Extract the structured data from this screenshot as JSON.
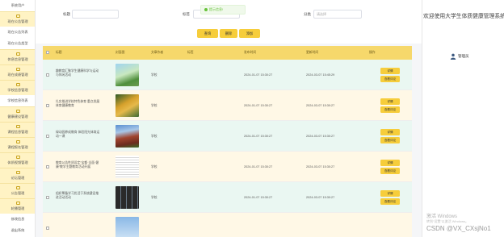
{
  "sidebar": {
    "items": [
      {
        "label": "系统用户",
        "group": false
      },
      {
        "label": "现在公告管理",
        "group": true
      },
      {
        "label": "现在公告列表",
        "group": false
      },
      {
        "label": "现在公告类型",
        "group": false
      },
      {
        "label": "休息信息管理",
        "group": true
      },
      {
        "label": "现在成绩管理",
        "group": true
      },
      {
        "label": "学校信息管理",
        "group": true
      },
      {
        "label": "学校信息列表",
        "group": false
      },
      {
        "label": "健康建议管理",
        "group": true
      },
      {
        "label": "课程信息管理",
        "group": true
      },
      {
        "label": "课程报名管理",
        "group": true
      },
      {
        "label": "体质视频管理",
        "group": true
      },
      {
        "label": "论坛管理",
        "group": true
      },
      {
        "label": "公告管理",
        "group": true
      },
      {
        "label": "轮播管理",
        "group": true
      },
      {
        "label": "修改信息",
        "group": false
      },
      {
        "label": "退出系统",
        "group": false
      }
    ]
  },
  "filter": {
    "label_name": "标题",
    "label_mid": "标签",
    "label_type": "分类",
    "type_placeholder": "请选择",
    "query_label": "查询",
    "delete_label": "删除",
    "add_label": "添加"
  },
  "toast": {
    "text": "提示信息!"
  },
  "table": {
    "headers": [
      "标题",
      "封面图",
      "文章作者",
      "标签",
      "发布时间",
      "更新时间",
      "操作"
    ],
    "detail_label": "详情",
    "edit_label": "查看评论",
    "rows": [
      {
        "title": "趣教育汇聚学生健康科学与运动与休闲活动",
        "author": "学校",
        "tag": "",
        "created": "2024-01-07 15:30:27",
        "updated": "2024-03-07 15:45:29",
        "thumb": "green"
      },
      {
        "title": "扎实推进学校特色体育 重点发展体育健康教育",
        "author": "学校",
        "tag": "",
        "created": "2024-01-07 15:30:27",
        "updated": "2024-03-07 15:30:27",
        "thumb": "autumn"
      },
      {
        "title": "绿动园养成教育 体验阳光体育运动一课",
        "author": "学校",
        "tag": "",
        "created": "2024-01-07 15:30:27",
        "updated": "2024-03-07 15:30:27",
        "thumb": "building"
      },
      {
        "title": "教育公告性质设定“宝都·全面·健康”教学主题教育活动开展",
        "author": "学校",
        "tag": "",
        "created": "2024-01-07 15:30:27",
        "updated": "2024-03-07 15:30:27",
        "thumb": "doc"
      },
      {
        "title": "组织筹备学习优活于系统建设推进活动活动",
        "author": "学校",
        "tag": "",
        "created": "2024-01-07 15:30:27",
        "updated": "2024-03-07 15:30:27",
        "thumb": "grid"
      },
      {
        "title": "",
        "author": "",
        "tag": "",
        "created": "",
        "updated": "",
        "thumb": "sky"
      }
    ]
  },
  "right": {
    "system_title": "欢迎使用大学生体质健康管理系统",
    "user_label": "管理员"
  },
  "watermark": {
    "line1": "激活 Windows",
    "line2": "转到“设置”以激活 Windows。"
  },
  "csdn": "CSDN @VX_CXsjNo1",
  "colors": {
    "accent": "#f6cd3b",
    "header": "#f6d86b",
    "row_alt": "#fff8e6",
    "row_plain": "#eaf7f2"
  }
}
